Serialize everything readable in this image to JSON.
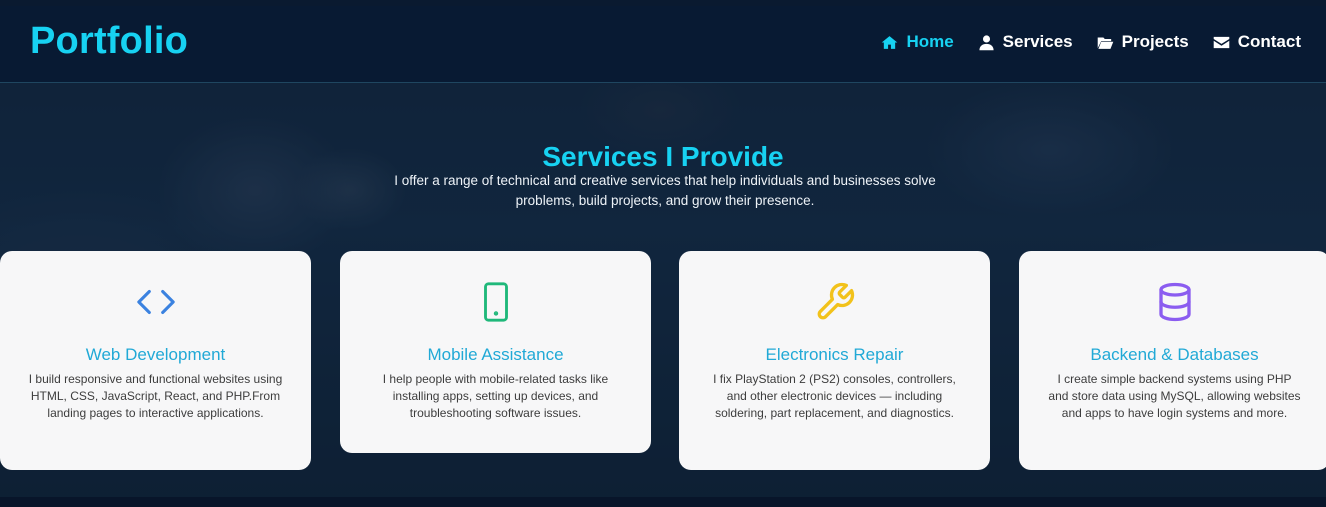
{
  "nav": {
    "brand": "Portfolio",
    "items": [
      {
        "label": "Home",
        "icon": "home-icon",
        "active": true
      },
      {
        "label": "Services",
        "icon": "user-icon",
        "active": false
      },
      {
        "label": "Projects",
        "icon": "folder-open-icon",
        "active": false
      },
      {
        "label": "Contact",
        "icon": "envelope-icon",
        "active": false
      }
    ]
  },
  "services": {
    "title": "Services I Provide",
    "subtitle": "I offer a range of technical and creative services that help individuals and businesses solve problems, build projects, and grow their presence.",
    "cards": [
      {
        "icon": "code-icon",
        "icon_color": "#3b82e0",
        "title": "Web Development",
        "description": "I build responsive and functional websites using HTML, CSS, JavaScript, React, and PHP.From landing pages to interactive applications."
      },
      {
        "icon": "mobile-icon",
        "icon_color": "#1fb87a",
        "title": "Mobile Assistance",
        "description": "I help people with mobile-related tasks like installing apps, setting up devices, and troubleshooting software issues."
      },
      {
        "icon": "wrench-icon",
        "icon_color": "#f2c21b",
        "title": "Electronics Repair",
        "description": "I fix PlayStation 2 (PS2) consoles, controllers, and other electronic devices — including soldering, part replacement, and diagnostics."
      },
      {
        "icon": "database-icon",
        "icon_color": "#8b5cf0",
        "title": "Backend & Databases",
        "description": "I create simple backend systems using PHP and store data using MySQL, allowing websites and apps to have login systems and more."
      }
    ]
  },
  "colors": {
    "accent": "#17d2f2",
    "nav_bg": "#081a33",
    "card_title": "#21a9d6"
  }
}
